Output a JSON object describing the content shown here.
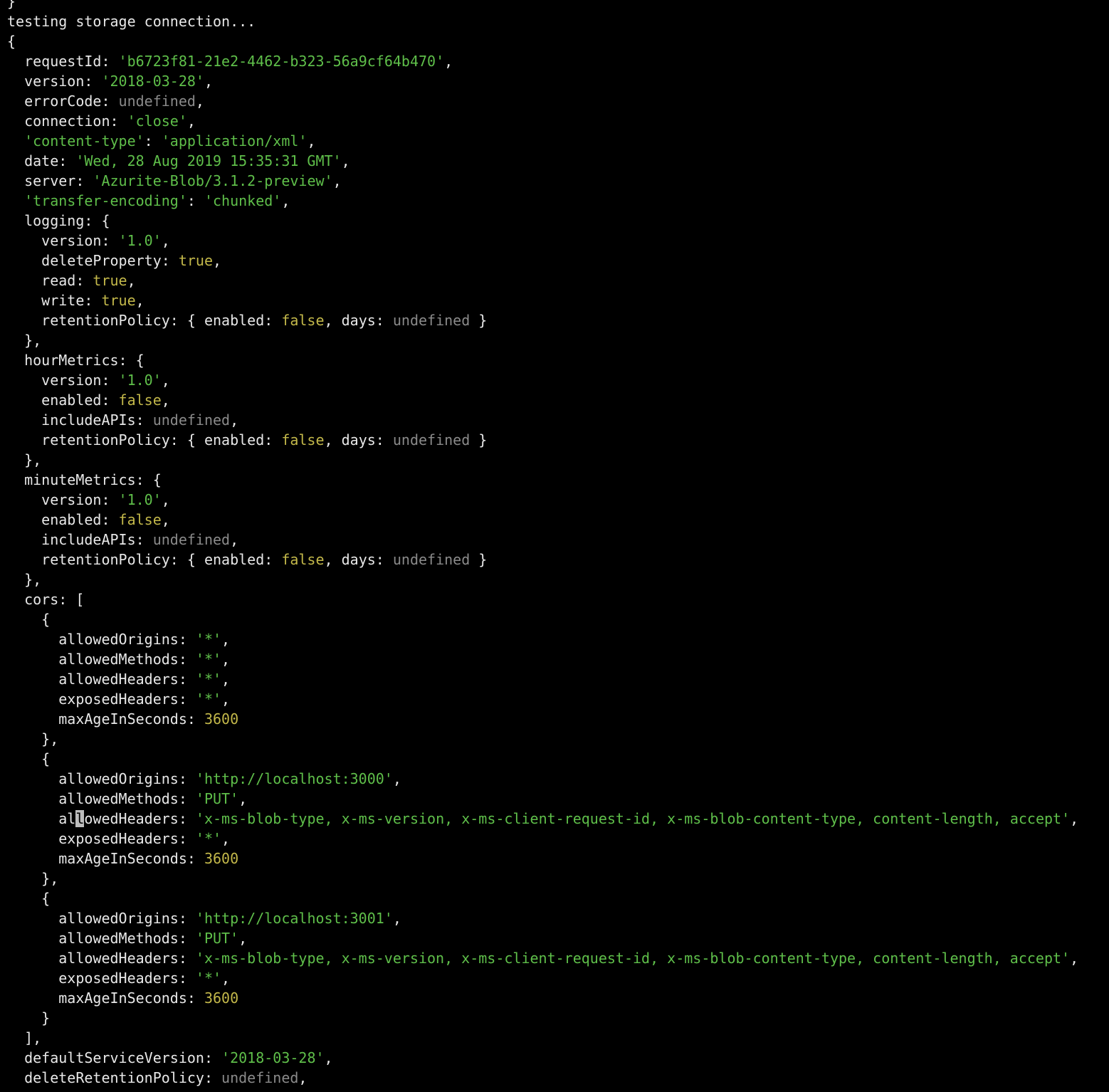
{
  "terminal": {
    "lines": [
      [
        {
          "t": "}",
          "c": "p"
        }
      ],
      [
        {
          "t": "testing storage connection...",
          "c": "p"
        }
      ],
      [
        {
          "t": "{",
          "c": "p"
        }
      ],
      [
        {
          "t": "  requestId: ",
          "c": "p"
        },
        {
          "t": "'b6723f81-21e2-4462-b323-56a9cf64b470'",
          "c": "str"
        },
        {
          "t": ",",
          "c": "p"
        }
      ],
      [
        {
          "t": "  version: ",
          "c": "p"
        },
        {
          "t": "'2018-03-28'",
          "c": "str"
        },
        {
          "t": ",",
          "c": "p"
        }
      ],
      [
        {
          "t": "  errorCode: ",
          "c": "p"
        },
        {
          "t": "undefined",
          "c": "undef"
        },
        {
          "t": ",",
          "c": "p"
        }
      ],
      [
        {
          "t": "  connection: ",
          "c": "p"
        },
        {
          "t": "'close'",
          "c": "str"
        },
        {
          "t": ",",
          "c": "p"
        }
      ],
      [
        {
          "t": "  ",
          "c": "p"
        },
        {
          "t": "'content-type'",
          "c": "str"
        },
        {
          "t": ": ",
          "c": "p"
        },
        {
          "t": "'application/xml'",
          "c": "str"
        },
        {
          "t": ",",
          "c": "p"
        }
      ],
      [
        {
          "t": "  date: ",
          "c": "p"
        },
        {
          "t": "'Wed, 28 Aug 2019 15:35:31 GMT'",
          "c": "str"
        },
        {
          "t": ",",
          "c": "p"
        }
      ],
      [
        {
          "t": "  server: ",
          "c": "p"
        },
        {
          "t": "'Azurite-Blob/3.1.2-preview'",
          "c": "str"
        },
        {
          "t": ",",
          "c": "p"
        }
      ],
      [
        {
          "t": "  ",
          "c": "p"
        },
        {
          "t": "'transfer-encoding'",
          "c": "str"
        },
        {
          "t": ": ",
          "c": "p"
        },
        {
          "t": "'chunked'",
          "c": "str"
        },
        {
          "t": ",",
          "c": "p"
        }
      ],
      [
        {
          "t": "  logging: {",
          "c": "p"
        }
      ],
      [
        {
          "t": "    version: ",
          "c": "p"
        },
        {
          "t": "'1.0'",
          "c": "str"
        },
        {
          "t": ",",
          "c": "p"
        }
      ],
      [
        {
          "t": "    deleteProperty: ",
          "c": "p"
        },
        {
          "t": "true",
          "c": "bool"
        },
        {
          "t": ",",
          "c": "p"
        }
      ],
      [
        {
          "t": "    read: ",
          "c": "p"
        },
        {
          "t": "true",
          "c": "bool"
        },
        {
          "t": ",",
          "c": "p"
        }
      ],
      [
        {
          "t": "    write: ",
          "c": "p"
        },
        {
          "t": "true",
          "c": "bool"
        },
        {
          "t": ",",
          "c": "p"
        }
      ],
      [
        {
          "t": "    retentionPolicy: { enabled: ",
          "c": "p"
        },
        {
          "t": "false",
          "c": "bool"
        },
        {
          "t": ", days: ",
          "c": "p"
        },
        {
          "t": "undefined",
          "c": "undef"
        },
        {
          "t": " }",
          "c": "p"
        }
      ],
      [
        {
          "t": "  },",
          "c": "p"
        }
      ],
      [
        {
          "t": "  hourMetrics: {",
          "c": "p"
        }
      ],
      [
        {
          "t": "    version: ",
          "c": "p"
        },
        {
          "t": "'1.0'",
          "c": "str"
        },
        {
          "t": ",",
          "c": "p"
        }
      ],
      [
        {
          "t": "    enabled: ",
          "c": "p"
        },
        {
          "t": "false",
          "c": "bool"
        },
        {
          "t": ",",
          "c": "p"
        }
      ],
      [
        {
          "t": "    includeAPIs: ",
          "c": "p"
        },
        {
          "t": "undefined",
          "c": "undef"
        },
        {
          "t": ",",
          "c": "p"
        }
      ],
      [
        {
          "t": "    retentionPolicy: { enabled: ",
          "c": "p"
        },
        {
          "t": "false",
          "c": "bool"
        },
        {
          "t": ", days: ",
          "c": "p"
        },
        {
          "t": "undefined",
          "c": "undef"
        },
        {
          "t": " }",
          "c": "p"
        }
      ],
      [
        {
          "t": "  },",
          "c": "p"
        }
      ],
      [
        {
          "t": "  minuteMetrics: {",
          "c": "p"
        }
      ],
      [
        {
          "t": "    version: ",
          "c": "p"
        },
        {
          "t": "'1.0'",
          "c": "str"
        },
        {
          "t": ",",
          "c": "p"
        }
      ],
      [
        {
          "t": "    enabled: ",
          "c": "p"
        },
        {
          "t": "false",
          "c": "bool"
        },
        {
          "t": ",",
          "c": "p"
        }
      ],
      [
        {
          "t": "    includeAPIs: ",
          "c": "p"
        },
        {
          "t": "undefined",
          "c": "undef"
        },
        {
          "t": ",",
          "c": "p"
        }
      ],
      [
        {
          "t": "    retentionPolicy: { enabled: ",
          "c": "p"
        },
        {
          "t": "false",
          "c": "bool"
        },
        {
          "t": ", days: ",
          "c": "p"
        },
        {
          "t": "undefined",
          "c": "undef"
        },
        {
          "t": " }",
          "c": "p"
        }
      ],
      [
        {
          "t": "  },",
          "c": "p"
        }
      ],
      [
        {
          "t": "  cors: [",
          "c": "p"
        }
      ],
      [
        {
          "t": "    {",
          "c": "p"
        }
      ],
      [
        {
          "t": "      allowedOrigins: ",
          "c": "p"
        },
        {
          "t": "'*'",
          "c": "str"
        },
        {
          "t": ",",
          "c": "p"
        }
      ],
      [
        {
          "t": "      allowedMethods: ",
          "c": "p"
        },
        {
          "t": "'*'",
          "c": "str"
        },
        {
          "t": ",",
          "c": "p"
        }
      ],
      [
        {
          "t": "      allowedHeaders: ",
          "c": "p"
        },
        {
          "t": "'*'",
          "c": "str"
        },
        {
          "t": ",",
          "c": "p"
        }
      ],
      [
        {
          "t": "      exposedHeaders: ",
          "c": "p"
        },
        {
          "t": "'*'",
          "c": "str"
        },
        {
          "t": ",",
          "c": "p"
        }
      ],
      [
        {
          "t": "      maxAgeInSeconds: ",
          "c": "p"
        },
        {
          "t": "3600",
          "c": "num"
        }
      ],
      [
        {
          "t": "    },",
          "c": "p"
        }
      ],
      [
        {
          "t": "    {",
          "c": "p"
        }
      ],
      [
        {
          "t": "      allowedOrigins: ",
          "c": "p"
        },
        {
          "t": "'http://localhost:3000'",
          "c": "str"
        },
        {
          "t": ",",
          "c": "p"
        }
      ],
      [
        {
          "t": "      allowedMethods: ",
          "c": "p"
        },
        {
          "t": "'PUT'",
          "c": "str"
        },
        {
          "t": ",",
          "c": "p"
        }
      ],
      [
        {
          "t": "      al",
          "c": "p"
        },
        {
          "t": "l",
          "c": "cursor"
        },
        {
          "t": "owedHeaders: ",
          "c": "p"
        },
        {
          "t": "'x-ms-blob-type, x-ms-version, x-ms-client-request-id, x-ms-blob-content-type, content-length, accept'",
          "c": "str"
        },
        {
          "t": ",",
          "c": "p"
        }
      ],
      [
        {
          "t": "      exposedHeaders: ",
          "c": "p"
        },
        {
          "t": "'*'",
          "c": "str"
        },
        {
          "t": ",",
          "c": "p"
        }
      ],
      [
        {
          "t": "      maxAgeInSeconds: ",
          "c": "p"
        },
        {
          "t": "3600",
          "c": "num"
        }
      ],
      [
        {
          "t": "    },",
          "c": "p"
        }
      ],
      [
        {
          "t": "    {",
          "c": "p"
        }
      ],
      [
        {
          "t": "      allowedOrigins: ",
          "c": "p"
        },
        {
          "t": "'http://localhost:3001'",
          "c": "str"
        },
        {
          "t": ",",
          "c": "p"
        }
      ],
      [
        {
          "t": "      allowedMethods: ",
          "c": "p"
        },
        {
          "t": "'PUT'",
          "c": "str"
        },
        {
          "t": ",",
          "c": "p"
        }
      ],
      [
        {
          "t": "      allowedHeaders: ",
          "c": "p"
        },
        {
          "t": "'x-ms-blob-type, x-ms-version, x-ms-client-request-id, x-ms-blob-content-type, content-length, accept'",
          "c": "str"
        },
        {
          "t": ",",
          "c": "p"
        }
      ],
      [
        {
          "t": "      exposedHeaders: ",
          "c": "p"
        },
        {
          "t": "'*'",
          "c": "str"
        },
        {
          "t": ",",
          "c": "p"
        }
      ],
      [
        {
          "t": "      maxAgeInSeconds: ",
          "c": "p"
        },
        {
          "t": "3600",
          "c": "num"
        }
      ],
      [
        {
          "t": "    }",
          "c": "p"
        }
      ],
      [
        {
          "t": "  ],",
          "c": "p"
        }
      ],
      [
        {
          "t": "  defaultServiceVersion: ",
          "c": "p"
        },
        {
          "t": "'2018-03-28'",
          "c": "str"
        },
        {
          "t": ",",
          "c": "p"
        }
      ],
      [
        {
          "t": "  deleteRetentionPolicy: ",
          "c": "p"
        },
        {
          "t": "undefined",
          "c": "undef"
        },
        {
          "t": ",",
          "c": "p"
        }
      ]
    ]
  },
  "colors": {
    "background": "#000000",
    "plain": "#e8e8e8",
    "string": "#5fbf4a",
    "boolean": "#c3b84a",
    "number": "#c3b84a",
    "undefined": "#8a8a8a"
  }
}
